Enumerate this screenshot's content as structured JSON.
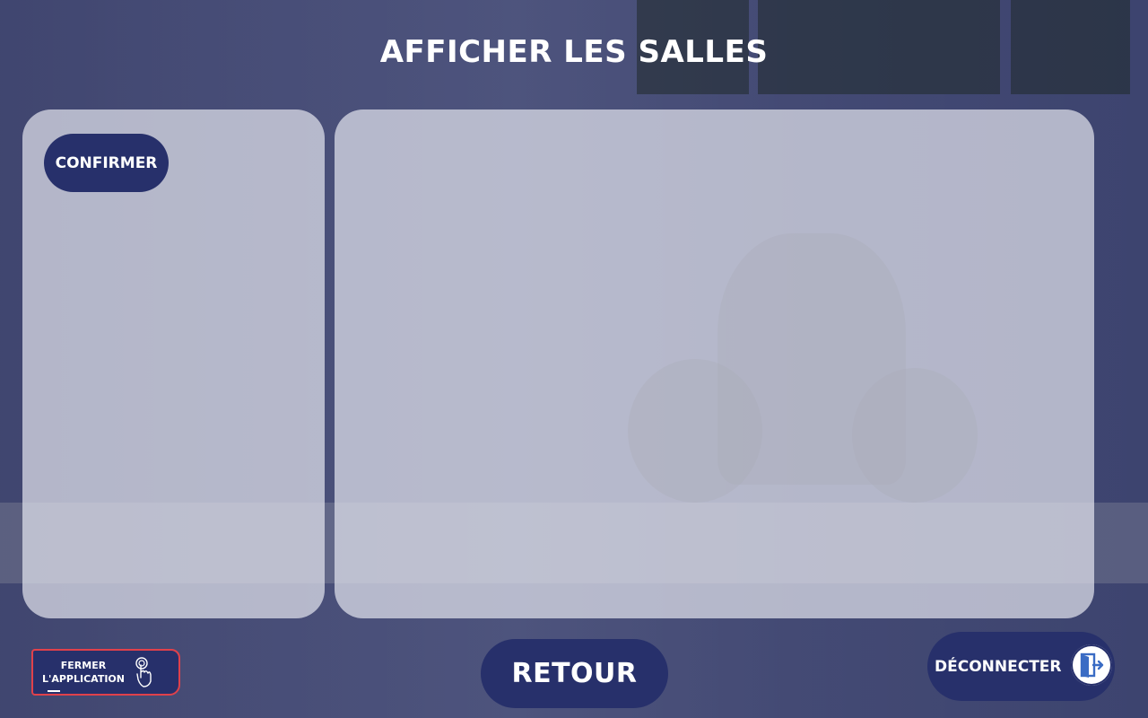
{
  "page": {
    "title": "AFFICHER LES SALLES"
  },
  "left_panel": {
    "confirm_label": "CONFIRMER"
  },
  "footer": {
    "close_app_line1": "FERMER",
    "close_app_line2": "L'APPLICATION",
    "back_label": "RETOUR",
    "logout_label": "DÉCONNECTER"
  },
  "icons": {
    "close_app": "touch-hand-icon",
    "logout": "door-exit-icon"
  },
  "colors": {
    "primary": "#27306b",
    "overlay": "#34407a",
    "panel": "#e0e2ec",
    "accent_border": "#e0414b",
    "text_light": "#ffffff"
  }
}
